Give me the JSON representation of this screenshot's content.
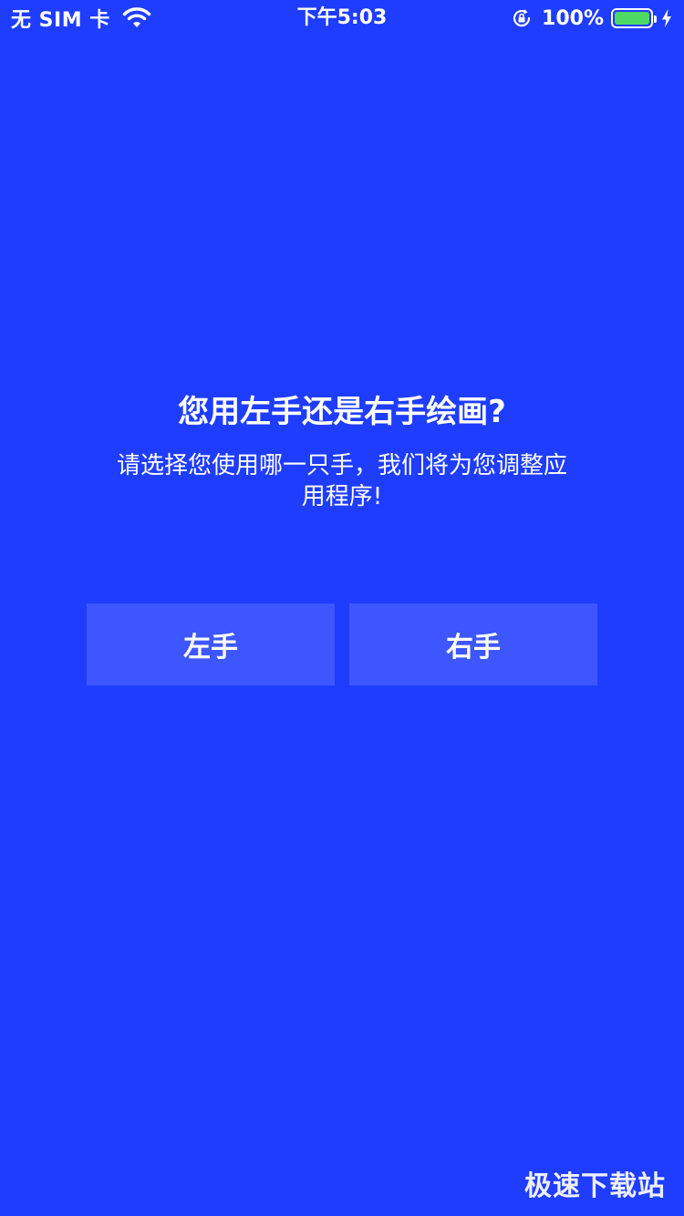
{
  "status_bar": {
    "carrier": "无 SIM 卡",
    "time": "下午5:03",
    "battery_percent": "100%",
    "battery_level": 1.0,
    "icons": [
      "wifi-icon",
      "rotation-lock-icon",
      "battery-icon",
      "charging-bolt-icon"
    ]
  },
  "prompt": {
    "title": "您用左手还是右手绘画?",
    "subtitle": "请选择您使用哪一只手，我们将为您调整应用程序!"
  },
  "buttons": {
    "left_hand": "左手",
    "right_hand": "右手"
  },
  "watermark": "极速下载站",
  "colors": {
    "background": "#1f3dff",
    "button": "#3d56ff",
    "text": "#ffffff",
    "battery": "#4cd964"
  }
}
